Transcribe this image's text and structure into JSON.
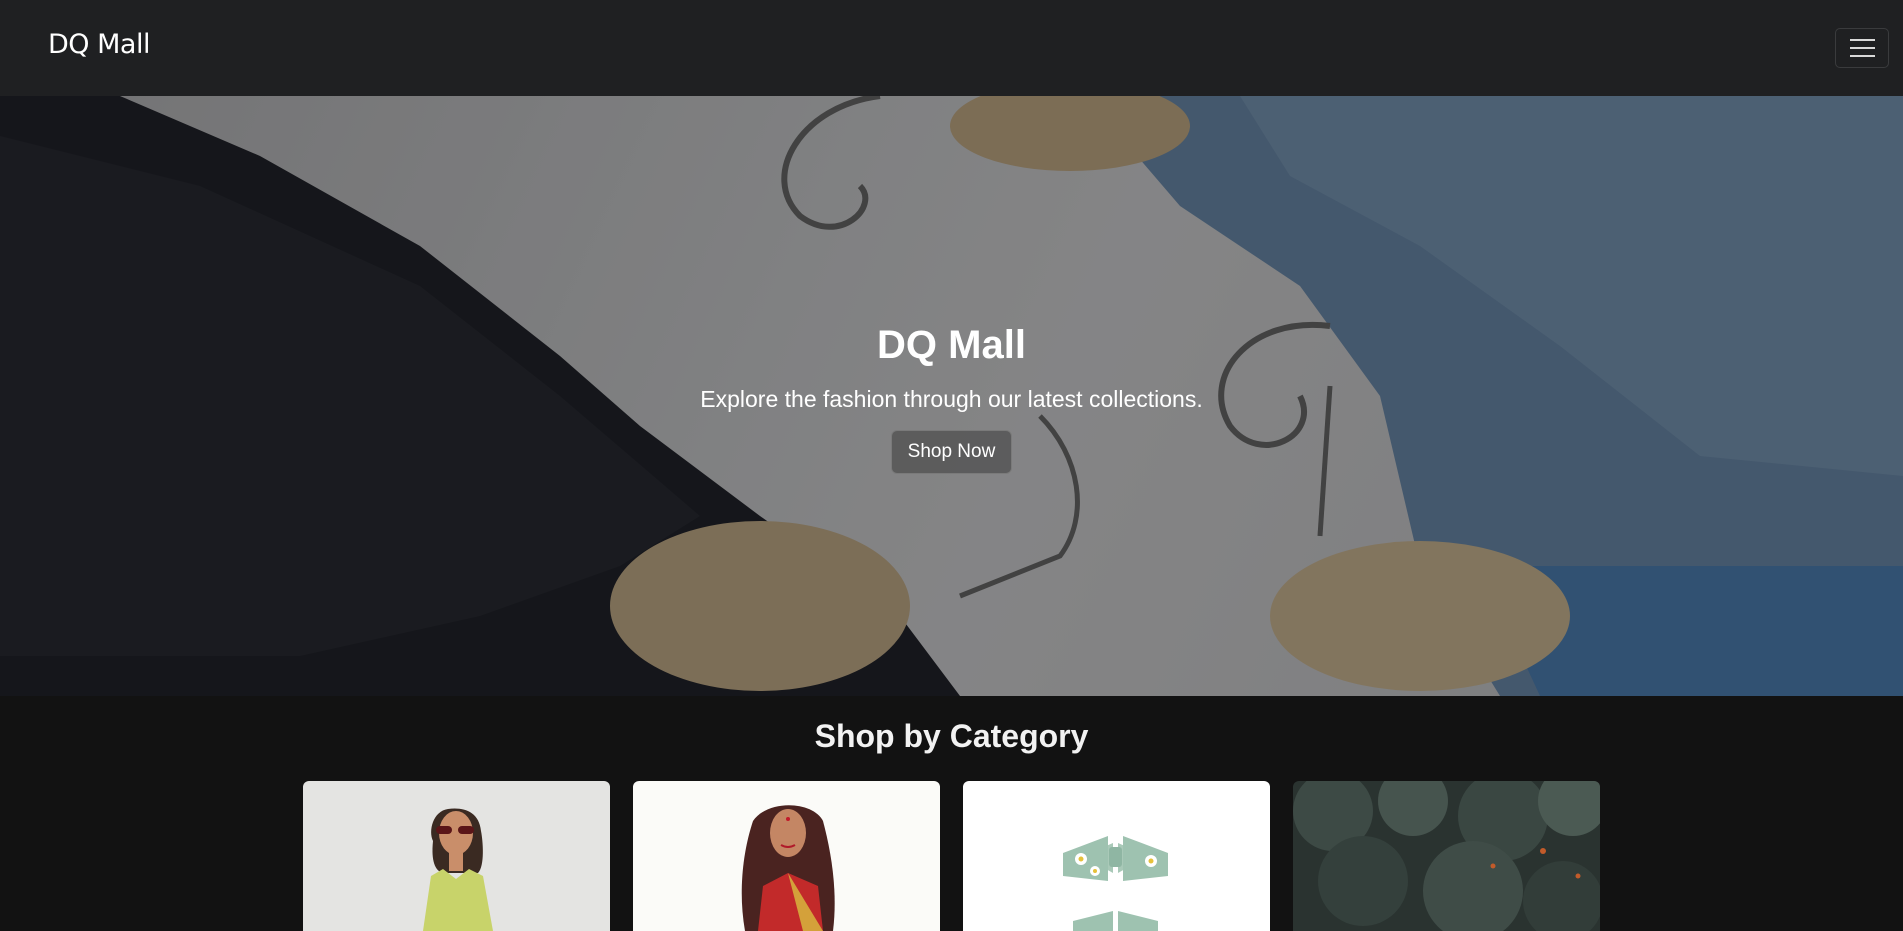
{
  "nav": {
    "brand": "DQ Mall",
    "toggle_icon": "hamburger-menu-icon"
  },
  "hero": {
    "title": "DQ Mall",
    "subtitle": "Explore the fashion through our latest collections.",
    "cta_label": "Shop Now"
  },
  "categories": {
    "heading": "Shop by Category",
    "items": [
      {
        "image": "woman-in-sunglasses-photo"
      },
      {
        "image": "saree-illustration"
      },
      {
        "image": "daisy-hair-bows-photo"
      },
      {
        "image": "dark-foliage-photo"
      }
    ]
  },
  "colors": {
    "navbar": "#1f2022",
    "page_bg": "#121212",
    "text": "#ffffff"
  }
}
